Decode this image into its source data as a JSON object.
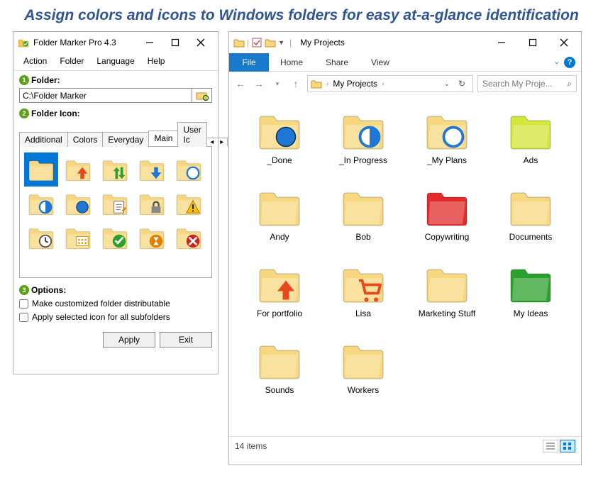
{
  "headline": "Assign colors and icons to Windows folders for easy at-a-glance identification",
  "fm": {
    "title": "Folder Marker Pro 4.3",
    "menu": [
      "Action",
      "Folder",
      "Language",
      "Help"
    ],
    "label_folder": "Folder:",
    "path": "C:\\Folder Marker",
    "label_icon": "Folder Icon:",
    "tabs": [
      "Additional",
      "Colors",
      "Everyday",
      "Main",
      "User Ic"
    ],
    "active_tab": "Main",
    "icons": [
      [
        {
          "overlay": "none",
          "selected": true
        },
        {
          "overlay": "arrow-up",
          "color": "#e8491b"
        },
        {
          "overlay": "arrow-updown",
          "color": "#2ca02c"
        },
        {
          "overlay": "arrow-down",
          "color": "#1f77d4"
        },
        {
          "overlay": "circle-empty",
          "color": "#1f77d4"
        }
      ],
      [
        {
          "overlay": "circle-half",
          "color": "#1f77d4"
        },
        {
          "overlay": "circle-full",
          "color": "#1f77d4"
        },
        {
          "overlay": "note",
          "color": "#666"
        },
        {
          "overlay": "lock",
          "color": "#666"
        },
        {
          "overlay": "warn",
          "color": "#f0a000"
        }
      ],
      [
        {
          "overlay": "clock",
          "color": "#666"
        },
        {
          "overlay": "grid",
          "color": "#e0a000"
        },
        {
          "overlay": "check",
          "color": "#2ca02c"
        },
        {
          "overlay": "hourglass",
          "color": "#e08000"
        },
        {
          "overlay": "deny",
          "color": "#d02020"
        }
      ]
    ],
    "label_options": "Options:",
    "opt1": "Make customized folder distributable",
    "opt2": "Apply selected icon for all subfolders",
    "btn_apply": "Apply",
    "btn_exit": "Exit"
  },
  "ex": {
    "title": "My Projects",
    "ribbon_file": "File",
    "ribbon_tabs": [
      "Home",
      "Share",
      "View"
    ],
    "breadcrumb": "My Projects",
    "search_placeholder": "Search My Proje...",
    "items": [
      {
        "label": "_Done",
        "fill": "#f7d77f",
        "overlay": "circle-full",
        "ocolor": "#1f77d4"
      },
      {
        "label": "_In Progress",
        "fill": "#f7d77f",
        "overlay": "circle-half",
        "ocolor": "#1f77d4"
      },
      {
        "label": "_My Plans",
        "fill": "#f7d77f",
        "overlay": "circle-empty",
        "ocolor": "#1f77d4"
      },
      {
        "label": "Ads",
        "fill": "#d3e63a"
      },
      {
        "label": "Andy",
        "fill": "#f7d77f"
      },
      {
        "label": "Bob",
        "fill": "#f7d77f"
      },
      {
        "label": "Copywriting",
        "fill": "#e22b2b"
      },
      {
        "label": "Documents",
        "fill": "#f7d77f"
      },
      {
        "label": "For portfolio",
        "fill": "#f7d77f",
        "overlay": "arrow-up",
        "ocolor": "#e8491b"
      },
      {
        "label": "Lisa",
        "fill": "#f7d77f",
        "overlay": "cart",
        "ocolor": "#e8491b"
      },
      {
        "label": "Marketing Stuff",
        "fill": "#f7d77f"
      },
      {
        "label": "My Ideas",
        "fill": "#2ca02c"
      },
      {
        "label": "Sounds",
        "fill": "#f7d77f"
      },
      {
        "label": "Workers",
        "fill": "#f7d77f"
      }
    ],
    "status": "14 items"
  }
}
